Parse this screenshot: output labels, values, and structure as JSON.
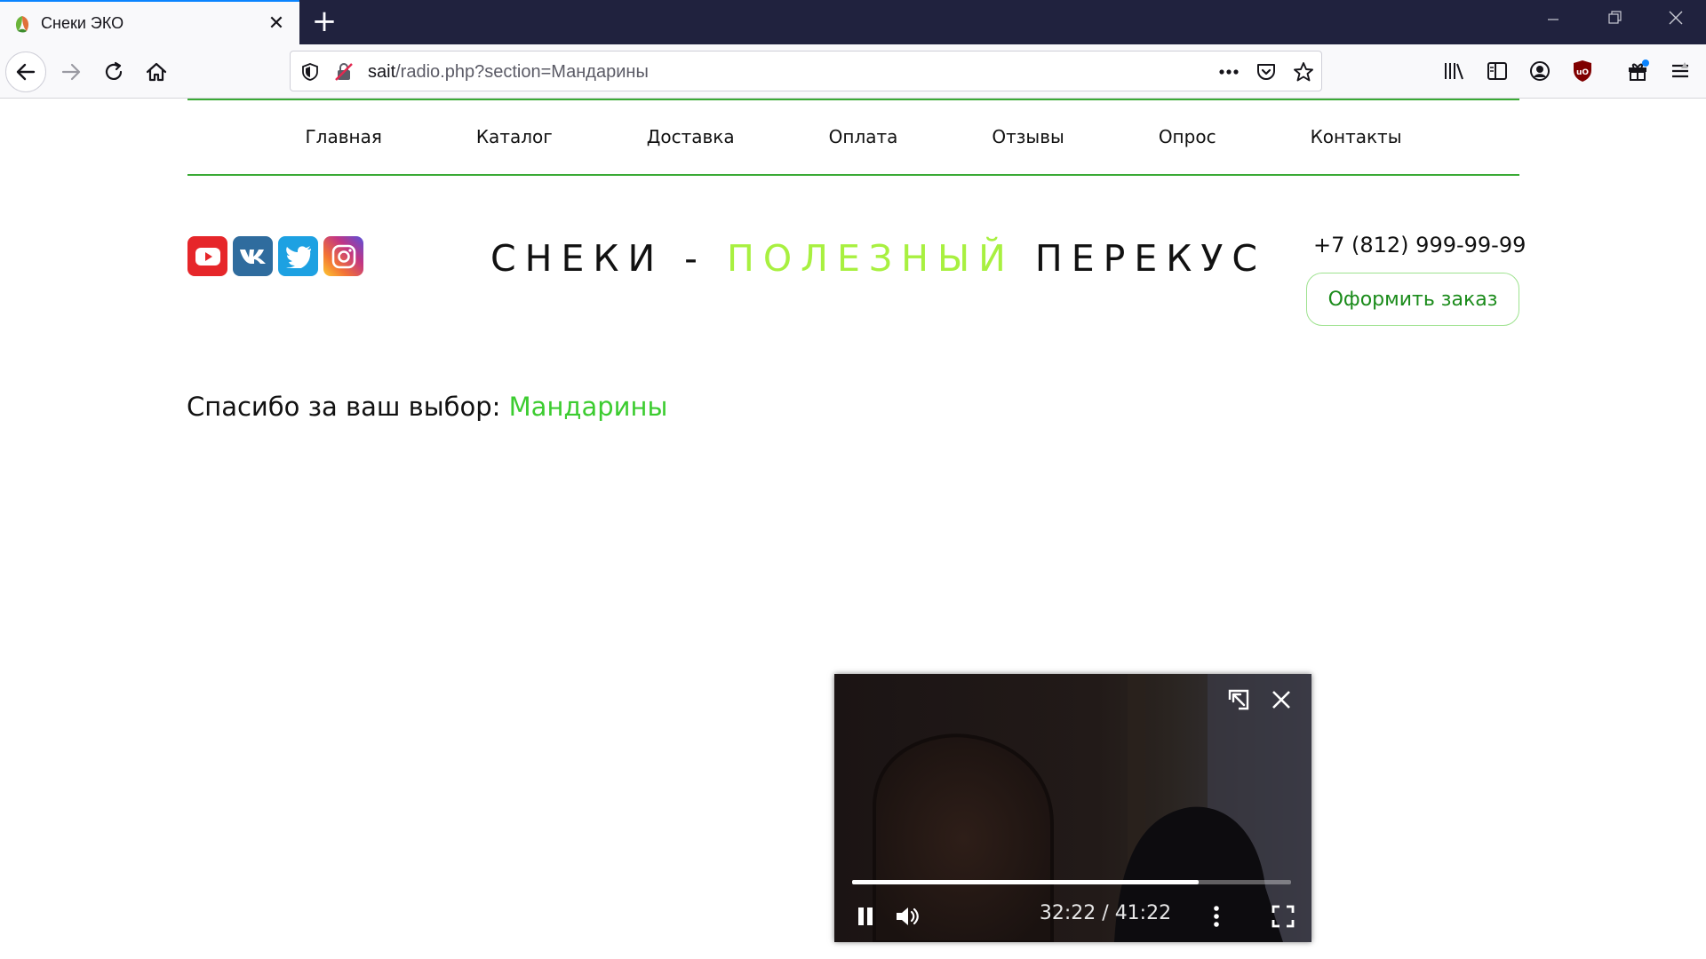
{
  "browser": {
    "tab": {
      "title": "Снеки ЭКО"
    },
    "url": {
      "host": "sait",
      "path": "/radio.php?section=Мандарины"
    },
    "nav_icons": [
      "back-arrow-icon",
      "forward-arrow-icon",
      "reload-icon",
      "home-icon"
    ],
    "toolbar_icons": [
      "library-icon",
      "sidebar-icon",
      "account-icon",
      "ublock-icon",
      "extensions-icon",
      "menu-icon"
    ]
  },
  "site": {
    "menu": [
      {
        "label": "Главная"
      },
      {
        "label": "Каталог"
      },
      {
        "label": "Доставка"
      },
      {
        "label": "Оплата"
      },
      {
        "label": "Отзывы"
      },
      {
        "label": "Опрос"
      },
      {
        "label": "Контакты"
      }
    ],
    "social": [
      {
        "name": "youtube-icon",
        "color": "#e6262a"
      },
      {
        "name": "vk-icon",
        "color": "#2f6c9e"
      },
      {
        "name": "twitter-icon",
        "color": "#1da1e2"
      },
      {
        "name": "instagram-icon",
        "color": "#c13584"
      }
    ],
    "slogan": {
      "part1": "СНЕКИ - ",
      "highlight": "ПОЛЕЗНЫЙ",
      "part2": " ПЕРЕКУС"
    },
    "phone": "+7 (812) 999-99-99",
    "order_button": "Оформить заказ",
    "thanks": {
      "prefix": "Спасибо за ваш выбор: ",
      "choice": "Мандарины"
    },
    "colors": {
      "accent_green": "#3aaa35",
      "slogan_highlight": "#a8f040",
      "choice": "#3ccc30"
    }
  },
  "video_pip": {
    "time": "32:22 / 41:22",
    "progress": 0.79
  }
}
